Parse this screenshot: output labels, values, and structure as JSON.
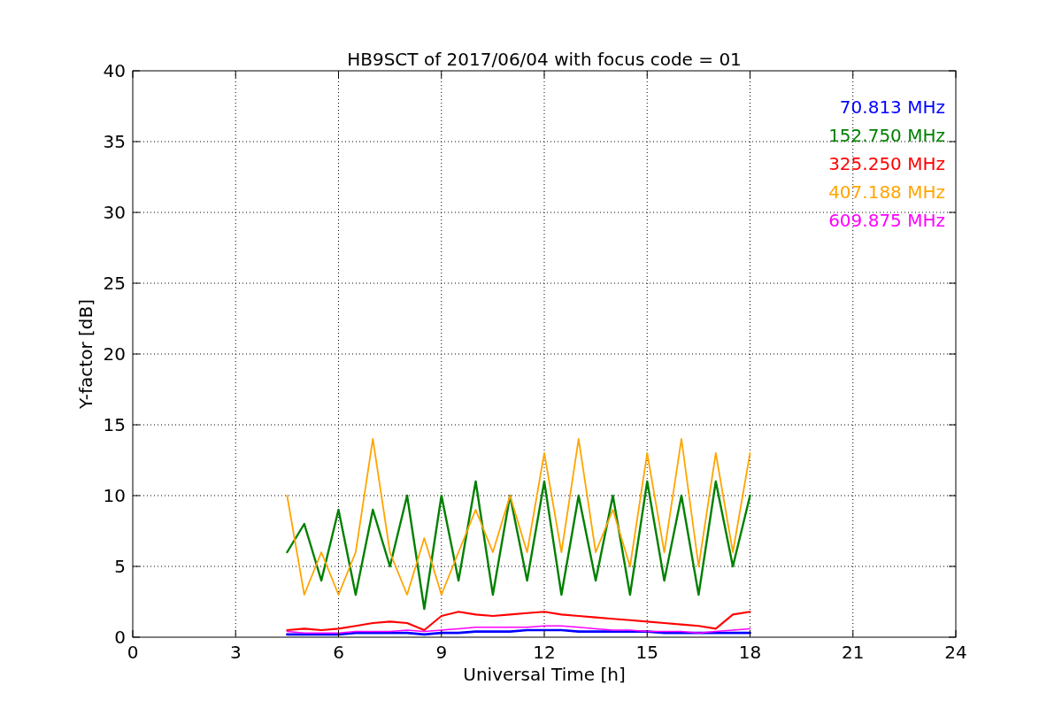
{
  "chart_data": {
    "type": "line",
    "title": "HB9SCT of 2017/06/04 with focus code = 01",
    "xlabel": "Universal Time [h]",
    "ylabel": "Y-factor [dB]",
    "xlim": [
      0,
      24
    ],
    "ylim": [
      0,
      40
    ],
    "xticks": [
      0,
      3,
      6,
      9,
      12,
      15,
      18,
      21,
      24
    ],
    "yticks": [
      0,
      5,
      10,
      15,
      20,
      25,
      30,
      35,
      40
    ],
    "grid": true,
    "x": [
      4.5,
      5,
      5.5,
      6,
      6.5,
      7,
      7.5,
      8,
      8.5,
      9,
      9.5,
      10,
      10.5,
      11,
      11.5,
      12,
      12.5,
      13,
      13.5,
      14,
      14.5,
      15,
      15.5,
      16,
      16.5,
      17,
      17.5,
      18
    ],
    "series": [
      {
        "name": "70.813 MHz",
        "color": "#0000ff",
        "values": [
          0.2,
          0.2,
          0.2,
          0.2,
          0.3,
          0.3,
          0.3,
          0.3,
          0.2,
          0.3,
          0.3,
          0.4,
          0.4,
          0.4,
          0.5,
          0.5,
          0.5,
          0.4,
          0.4,
          0.4,
          0.4,
          0.4,
          0.3,
          0.3,
          0.3,
          0.3,
          0.3,
          0.3
        ]
      },
      {
        "name": "152.750 MHz",
        "color": "#008000",
        "values": [
          6,
          8,
          4,
          9,
          3,
          9,
          5,
          10,
          2,
          10,
          4,
          11,
          3,
          10,
          4,
          11,
          3,
          10,
          4,
          10,
          3,
          11,
          4,
          10,
          3,
          11,
          5,
          10
        ]
      },
      {
        "name": "325.250 MHz",
        "color": "#ff0000",
        "values": [
          0.5,
          0.6,
          0.5,
          0.6,
          0.8,
          1,
          1.1,
          1,
          0.5,
          1.5,
          1.8,
          1.6,
          1.5,
          1.6,
          1.7,
          1.8,
          1.6,
          1.5,
          1.4,
          1.3,
          1.2,
          1.1,
          1,
          0.9,
          0.8,
          0.6,
          1.6,
          1.8
        ]
      },
      {
        "name": "407.188 MHz",
        "color": "#ffa500",
        "values": [
          10,
          3,
          6,
          3,
          6,
          14,
          6,
          3,
          7,
          3,
          6,
          9,
          6,
          10,
          6,
          13,
          6,
          14,
          6,
          9,
          5,
          13,
          6,
          14,
          5,
          13,
          6,
          13
        ]
      },
      {
        "name": "609.875 MHz",
        "color": "#ff00ff",
        "values": [
          0.4,
          0.3,
          0.3,
          0.3,
          0.4,
          0.4,
          0.4,
          0.5,
          0.4,
          0.5,
          0.6,
          0.7,
          0.7,
          0.7,
          0.7,
          0.8,
          0.8,
          0.7,
          0.6,
          0.5,
          0.5,
          0.4,
          0.4,
          0.4,
          0.3,
          0.4,
          0.5,
          0.6
        ]
      }
    ]
  }
}
